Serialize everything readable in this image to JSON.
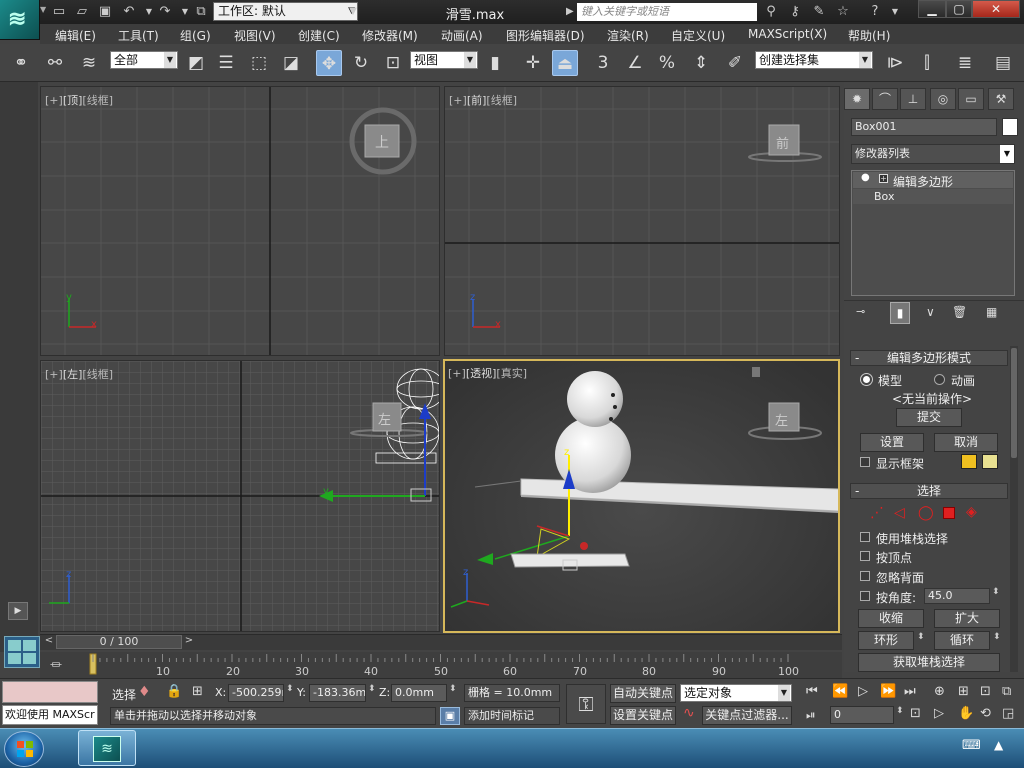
{
  "titlebar": {
    "workspace": "工作区: 默认",
    "document_title": "滑雪.max",
    "search_placeholder": "键入关键字或短语"
  },
  "menu": [
    {
      "label": "编辑(E)"
    },
    {
      "label": "工具(T)"
    },
    {
      "label": "组(G)"
    },
    {
      "label": "视图(V)"
    },
    {
      "label": "创建(C)"
    },
    {
      "label": "修改器(M)"
    },
    {
      "label": "动画(A)"
    },
    {
      "label": "图形编辑器(D)"
    },
    {
      "label": "渲染(R)"
    },
    {
      "label": "自定义(U)"
    },
    {
      "label": "MAXScript(X)"
    },
    {
      "label": "帮助(H)"
    }
  ],
  "toolbar": {
    "selection_filter": "全部",
    "reference_coord": "视图",
    "named_selection": "创建选择集",
    "snap_3": "3",
    "percent": "%"
  },
  "viewports": {
    "top": {
      "plus": "[+]",
      "name": "[顶]",
      "mode": "[线框]",
      "cube": "上"
    },
    "front": {
      "plus": "[+]",
      "name": "[前]",
      "mode": "[线框]",
      "cube": "前"
    },
    "left": {
      "plus": "[+]",
      "name": "[左]",
      "mode": "[线框]",
      "cube": "左"
    },
    "perspective": {
      "plus": "[+]",
      "name": "[透视]",
      "mode": "[真实]",
      "cube": "左"
    }
  },
  "axes": {
    "x": "x",
    "y": "y",
    "z": "z"
  },
  "command_panel": {
    "object_name": "Box001",
    "modifier_list": "修改器列表",
    "stack": [
      "编辑多边形",
      "Box"
    ],
    "edit_poly_mode": {
      "title": "编辑多边形模式",
      "option_model": "模型",
      "option_animate": "动画",
      "no_op": "<无当前操作>",
      "commit": "提交",
      "settings": "设置",
      "cancel": "取消",
      "show_cage": "显示框架"
    },
    "selection": {
      "title": "选择",
      "use_stack": "使用堆栈选择",
      "by_vertex": "按顶点",
      "ignore_backface": "忽略背面",
      "by_angle": "按角度:",
      "angle_value": "45.0",
      "shrink": "收缩",
      "grow": "扩大",
      "ring": "环形",
      "loop": "循环",
      "get_stack": "获取堆栈选择"
    },
    "colors": {
      "cage_1": "#f0c020",
      "cage_2": "#e8e090",
      "select_red": "#e02020"
    }
  },
  "timeline": {
    "frame_counter": "0 / 100",
    "ticks": [
      "10",
      "20",
      "30",
      "40",
      "50",
      "60",
      "70",
      "80",
      "90",
      "100"
    ]
  },
  "status": {
    "welcome": "欢迎使用 MAXScr",
    "select_label": "选择",
    "x_label": "X:",
    "x_value": "-500.259m",
    "y_label": "Y:",
    "y_value": "-183.36mm",
    "z_label": "Z:",
    "z_value": "0.0mm",
    "grid": "栅格 = 10.0mm",
    "prompt": "单击并拖动以选择并移动对象",
    "add_time_tag": "添加时间标记",
    "auto_key": "自动关键点",
    "set_key": "设置关键点",
    "selected_object": "选定对象",
    "key_filters": "关键点过滤器...",
    "frame_value": "0"
  }
}
